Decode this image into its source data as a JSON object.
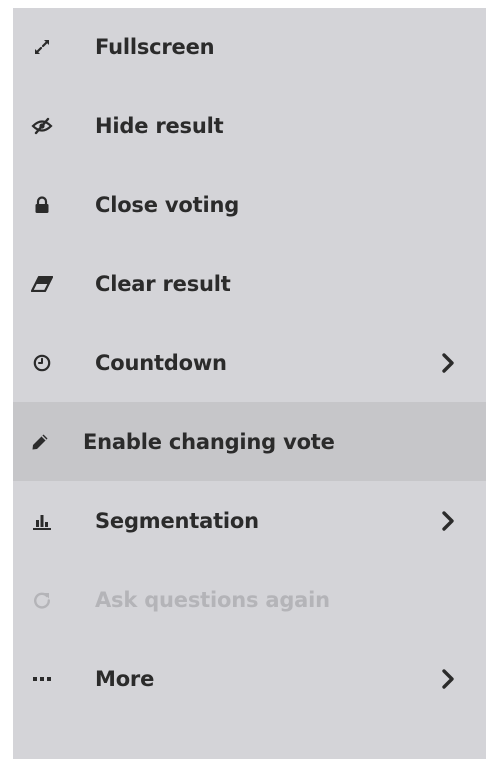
{
  "menu": {
    "items": [
      {
        "label": "Fullscreen",
        "icon": "expand-icon",
        "submenu": false,
        "state": "normal"
      },
      {
        "label": "Hide result",
        "icon": "eye-slash-icon",
        "submenu": false,
        "state": "normal"
      },
      {
        "label": "Close voting",
        "icon": "lock-icon",
        "submenu": false,
        "state": "normal"
      },
      {
        "label": "Clear result",
        "icon": "eraser-icon",
        "submenu": false,
        "state": "normal"
      },
      {
        "label": "Countdown",
        "icon": "clock-icon",
        "submenu": true,
        "state": "normal"
      },
      {
        "label": "Enable changing vote",
        "icon": "pencil-icon",
        "submenu": false,
        "state": "hovered"
      },
      {
        "label": "Segmentation",
        "icon": "bar-chart-icon",
        "submenu": true,
        "state": "normal"
      },
      {
        "label": "Ask questions again",
        "icon": "redo-icon",
        "submenu": false,
        "state": "disabled"
      },
      {
        "label": "More",
        "icon": "ellipsis-icon",
        "submenu": true,
        "state": "normal"
      }
    ]
  },
  "colors": {
    "menu_background": "#d4d4d8",
    "hover_background": "#c6c6c9",
    "text": "#2b2b2b",
    "disabled_text": "#b4b4b8"
  }
}
